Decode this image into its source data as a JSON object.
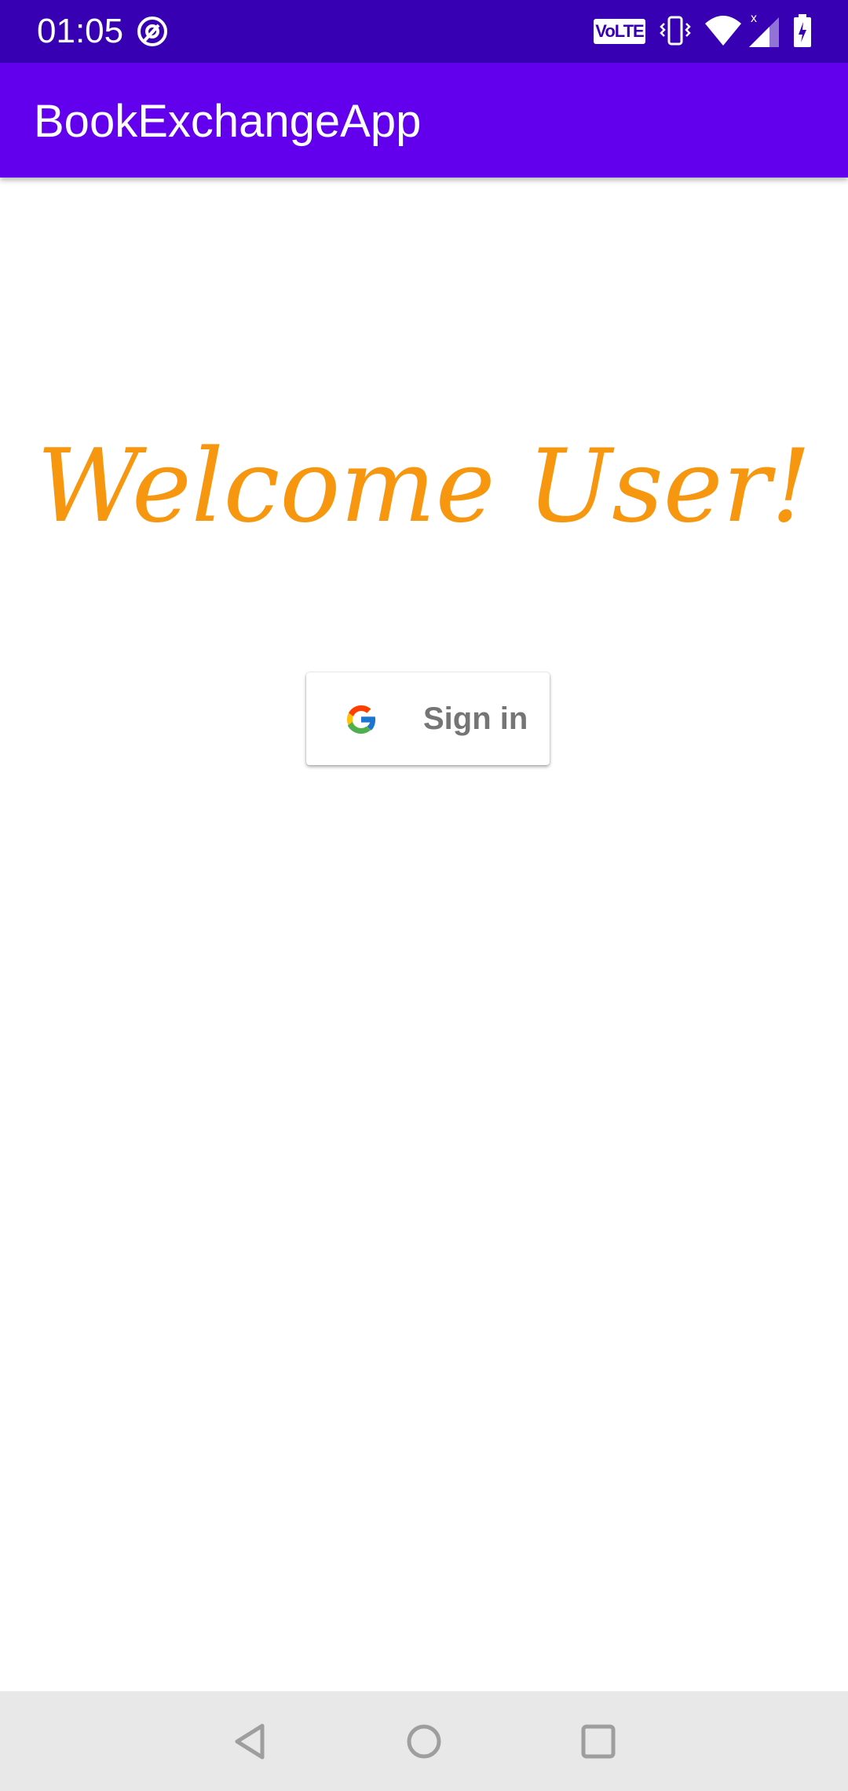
{
  "status_bar": {
    "time": "01:05",
    "volte_label": "VoLTE",
    "icons": [
      "at-sign-icon",
      "vibrate-icon",
      "wifi-icon",
      "signal-icon",
      "battery-charging-icon"
    ]
  },
  "app_bar": {
    "title": "BookExchangeApp",
    "color": "#6200ee",
    "status_color": "#3700b3"
  },
  "main": {
    "welcome_text": "Welcome User!",
    "welcome_color": "#f7960f",
    "signin_label": "Sign in",
    "signin_icon": "google-icon"
  },
  "nav_bar": {
    "buttons": [
      "back-icon",
      "home-icon",
      "recents-icon"
    ]
  }
}
